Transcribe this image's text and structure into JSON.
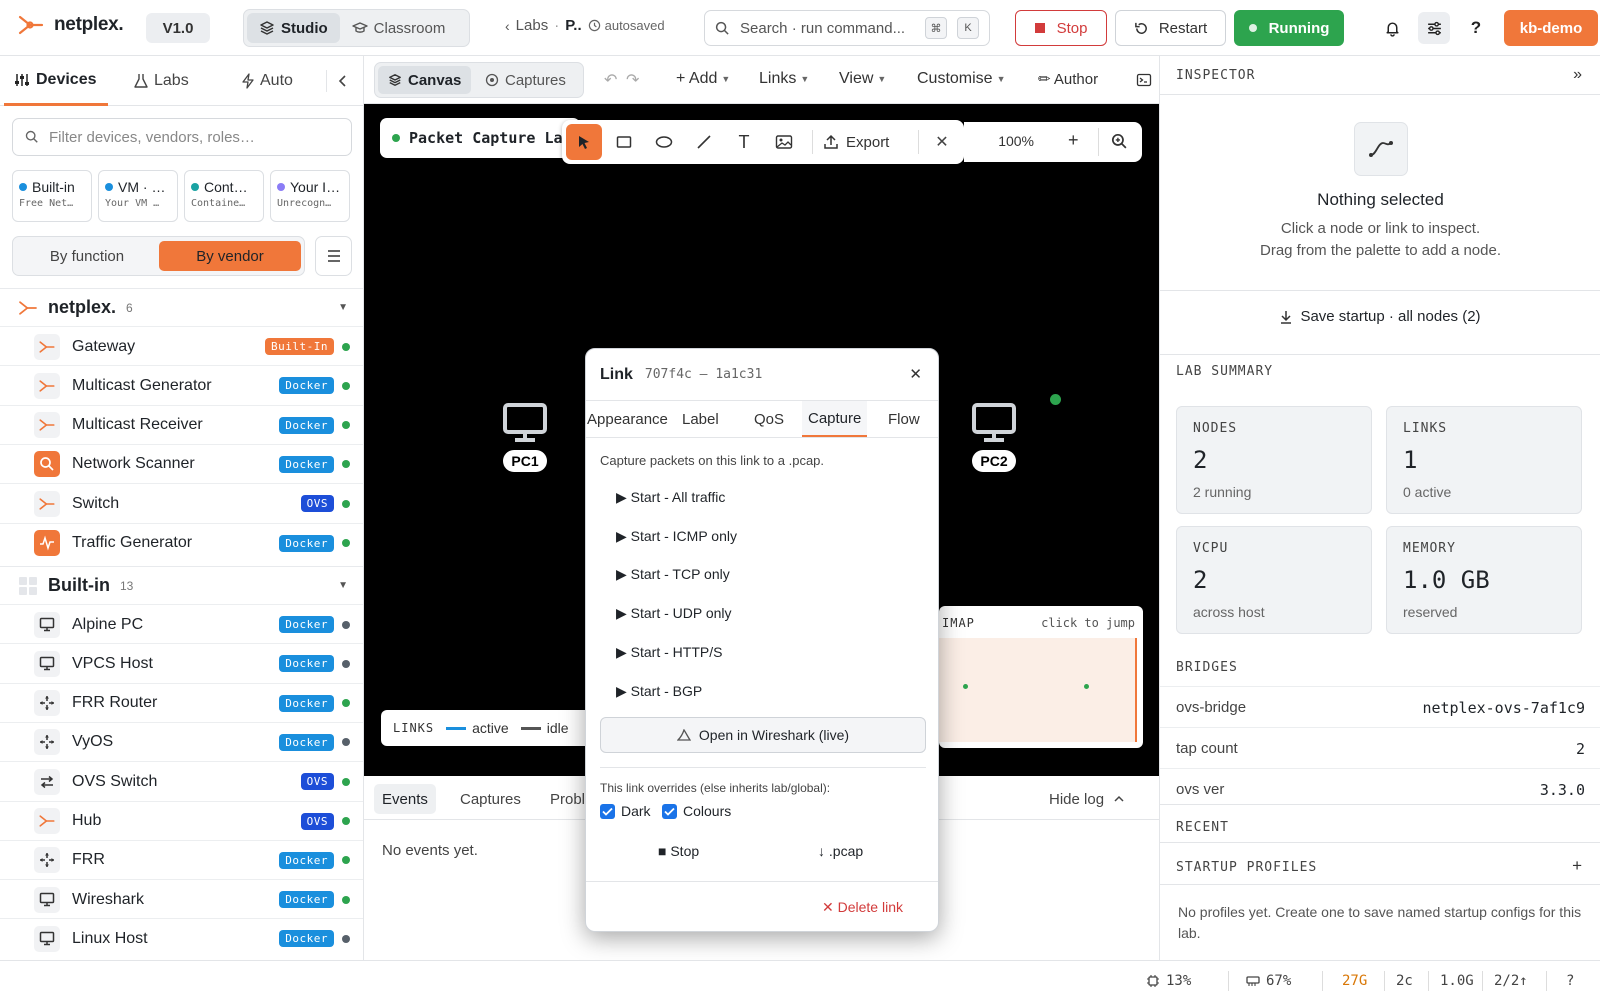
{
  "brand": {
    "name": "netplex.",
    "version": "V1.0",
    "accent": "#f0773a"
  },
  "modes": [
    "Studio",
    "Classroom"
  ],
  "breadcrumb": {
    "parent": "Labs",
    "current": "P..",
    "status": "autosaved"
  },
  "search": {
    "placeholder": "Search · run command...",
    "key1": "⌘",
    "key2": "K"
  },
  "controls": {
    "stop": "Stop",
    "restart": "Restart",
    "running": "Running"
  },
  "user": "kb-demo",
  "left": {
    "tabs": [
      "Devices",
      "Labs",
      "Auto"
    ],
    "filter_placeholder": "Filter devices, vendors, roles…",
    "chips": [
      {
        "title": "Built-in",
        "sub": "Free Net…",
        "color": "#1a8fdd"
      },
      {
        "title": "VM · …",
        "sub": "Your VM …",
        "color": "#1a8fdd"
      },
      {
        "title": "Cont…",
        "sub": "Containe…",
        "color": "#1aa3a3"
      },
      {
        "title": "Your I…",
        "sub": "Unrecogn…",
        "color": "#8b7cf6"
      }
    ],
    "group_by": [
      "By function",
      "By vendor"
    ],
    "groups": [
      {
        "name": "netplex.",
        "count": "6"
      },
      {
        "name": "Built-in",
        "count": "13"
      }
    ],
    "netplex_devices": [
      {
        "name": "Gateway",
        "badge": "Built-In",
        "kind": "builtin",
        "status": "#2da44e"
      },
      {
        "name": "Multicast Generator",
        "badge": "Docker",
        "kind": "docker",
        "status": "#2da44e"
      },
      {
        "name": "Multicast Receiver",
        "badge": "Docker",
        "kind": "docker",
        "status": "#2da44e"
      },
      {
        "name": "Network Scanner",
        "badge": "Docker",
        "kind": "docker",
        "status": "#2da44e"
      },
      {
        "name": "Switch",
        "badge": "OVS",
        "kind": "ovs",
        "status": "#2da44e"
      },
      {
        "name": "Traffic Generator",
        "badge": "Docker",
        "kind": "docker",
        "status": "#2da44e"
      }
    ],
    "builtin_devices": [
      {
        "name": "Alpine PC",
        "badge": "Docker",
        "kind": "docker",
        "status": "#57606a"
      },
      {
        "name": "VPCS Host",
        "badge": "Docker",
        "kind": "docker",
        "status": "#57606a"
      },
      {
        "name": "FRR Router",
        "badge": "Docker",
        "kind": "docker",
        "status": "#2da44e"
      },
      {
        "name": "VyOS",
        "badge": "Docker",
        "kind": "docker",
        "status": "#57606a"
      },
      {
        "name": "OVS Switch",
        "badge": "OVS",
        "kind": "ovs",
        "status": "#2da44e"
      },
      {
        "name": "Hub",
        "badge": "OVS",
        "kind": "ovs",
        "status": "#2da44e"
      },
      {
        "name": "FRR",
        "badge": "Docker",
        "kind": "docker",
        "status": "#2da44e"
      },
      {
        "name": "Wireshark",
        "badge": "Docker",
        "kind": "docker",
        "status": "#2da44e"
      },
      {
        "name": "Linux Host",
        "badge": "Docker",
        "kind": "docker",
        "status": "#57606a"
      }
    ]
  },
  "center": {
    "tabs": [
      "Canvas",
      "Captures"
    ],
    "menus": [
      "+ Add",
      "Links",
      "View",
      "Customise"
    ],
    "author": "✏ Author",
    "lab_title": "Packet Capture La",
    "export": "Export",
    "zoom": "100%",
    "nodes": [
      "PC1",
      "PC2"
    ],
    "legend": {
      "title": "LINKS",
      "active": "active",
      "idle": "idle"
    },
    "minimap": {
      "title": "IMAP",
      "hint": "click to jump"
    },
    "log_tabs": [
      "Events",
      "Captures",
      "Probl"
    ],
    "hide_log": "Hide log",
    "empty_log": "No events yet."
  },
  "modal": {
    "title": "Link",
    "id": "707f4c — 1a1c31",
    "tabs": [
      "Appearance",
      "Label",
      "QoS",
      "Capture",
      "Flow"
    ],
    "intro": "Capture packets on this link to a .pcap.",
    "captures": [
      "▶ Start - All traffic",
      "▶ Start - ICMP only",
      "▶ Start - TCP only",
      "▶ Start - UDP only",
      "▶ Start - HTTP/S",
      "▶ Start - BGP"
    ],
    "wireshark": "Open in Wireshark (live)",
    "overrides_note": "This link overrides (else inherits lab/global):",
    "opt_dark": "Dark",
    "opt_colours": "Colours",
    "stop": "■ Stop",
    "pcap": "↓ .pcap",
    "delete": "✕ Delete link"
  },
  "inspector": {
    "title": "INSPECTOR",
    "empty_title": "Nothing selected",
    "empty_line1": "Click a node or link to inspect.",
    "empty_line2": "Drag from the palette to add a node.",
    "save_startup": "Save startup · all nodes (2)"
  },
  "lab_summary": {
    "title": "LAB SUMMARY",
    "stats": [
      {
        "key": "NODES",
        "value": "2",
        "sub": "2 running"
      },
      {
        "key": "LINKS",
        "value": "1",
        "sub": "0 active"
      },
      {
        "key": "VCPU",
        "value": "2",
        "sub": "across host"
      },
      {
        "key": "MEMORY",
        "value": "1.0 GB",
        "sub": "reserved"
      }
    ]
  },
  "bridges": {
    "title": "BRIDGES",
    "rows": [
      {
        "k": "ovs-bridge",
        "v": "netplex-ovs-7af1c9"
      },
      {
        "k": "tap count",
        "v": "2"
      },
      {
        "k": "ovs ver",
        "v": "3.3.0"
      }
    ]
  },
  "recent": {
    "title": "RECENT"
  },
  "startup_profiles": {
    "title": "STARTUP PROFILES",
    "add": "+",
    "empty": "No profiles yet. Create one to save named startup configs for this lab."
  },
  "statusbar": {
    "cpu": "13%",
    "mem": "67%",
    "disk": "27G",
    "cores": "2c",
    "ram": "1.0G",
    "net": "2/2↑",
    "help": "?"
  }
}
